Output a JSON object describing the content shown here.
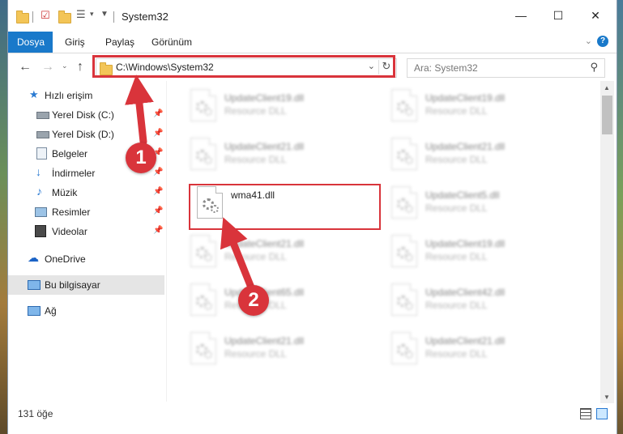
{
  "window": {
    "title": "System32",
    "minimize_glyph": "—",
    "maximize_glyph": "☐",
    "close_glyph": "✕"
  },
  "ribbon": {
    "tabs": [
      "Dosya",
      "Giriş",
      "Paylaş",
      "Görünüm"
    ],
    "help_glyph": "?"
  },
  "nav": {
    "address": "C:\\Windows\\System32",
    "search_placeholder": "Ara: System32"
  },
  "sidebar": {
    "items": [
      {
        "label": "Hızlı erişim",
        "icon": "star-icon"
      },
      {
        "label": "Yerel Disk (C:)",
        "icon": "drive-icon"
      },
      {
        "label": "Yerel Disk (D:)",
        "icon": "drive-icon"
      },
      {
        "label": "Belgeler",
        "icon": "documents-icon"
      },
      {
        "label": "İndirmeler",
        "icon": "download-icon"
      },
      {
        "label": "Müzik",
        "icon": "music-icon"
      },
      {
        "label": "Resimler",
        "icon": "pictures-icon"
      },
      {
        "label": "Videolar",
        "icon": "video-icon"
      },
      {
        "label": "OneDrive",
        "icon": "cloud-icon"
      },
      {
        "label": "Bu bilgisayar",
        "icon": "computer-icon"
      },
      {
        "label": "Ağ",
        "icon": "network-icon"
      }
    ]
  },
  "files": [
    {
      "name": "UpdateClient19.dll",
      "type": "Resource DLL"
    },
    {
      "name": "UpdateClient19.dll",
      "type": "Resource DLL"
    },
    {
      "name": "UpdateClient21.dll",
      "type": "Resource DLL"
    },
    {
      "name": "UpdateClient21.dll",
      "type": "Resource DLL"
    },
    {
      "name": "wma41.dll",
      "type": ""
    },
    {
      "name": "UpdateClient5.dll",
      "type": "Resource DLL"
    },
    {
      "name": "UpdateClient21.dll",
      "type": "Resource DLL"
    },
    {
      "name": "UpdateClient19.dll",
      "type": "Resource DLL"
    },
    {
      "name": "UpdateClient65.dll",
      "type": "Resource DLL"
    },
    {
      "name": "UpdateClient42.dll",
      "type": "Resource DLL"
    },
    {
      "name": "UpdateClient21.dll",
      "type": "Resource DLL"
    },
    {
      "name": "UpdateClient21.dll",
      "type": "Resource DLL"
    }
  ],
  "status": {
    "item_count": "131 öğe"
  },
  "annotations": {
    "step1": "1",
    "step2": "2",
    "color": "#d9343b"
  }
}
